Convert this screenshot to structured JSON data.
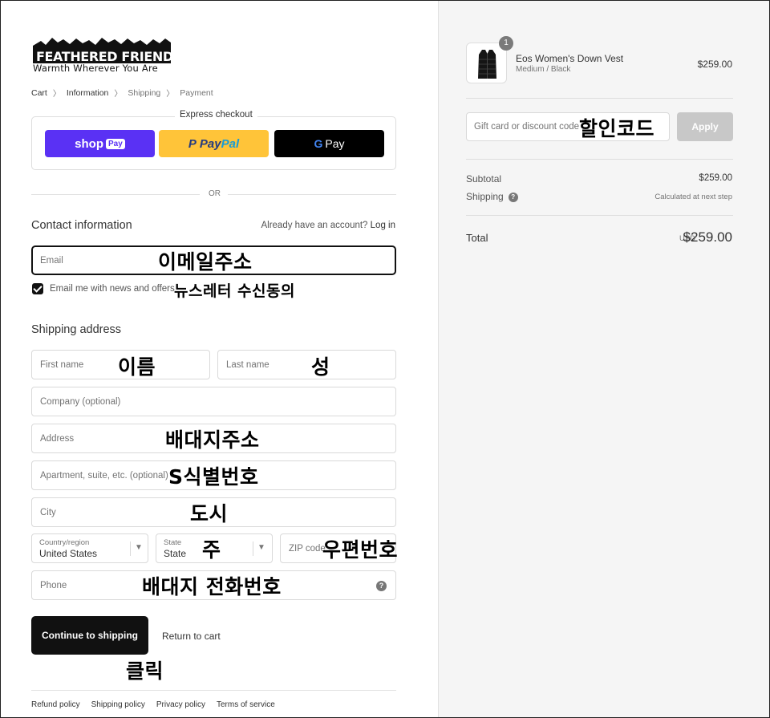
{
  "brand": {
    "name": "FEATHERED FRIENDS",
    "tagline": "Warmth Wherever You Are"
  },
  "breadcrumb": [
    "Cart",
    "Information",
    "Shipping",
    "Payment"
  ],
  "express": {
    "title": "Express checkout",
    "shop_pay": "shop",
    "shop_pay_badge": "Pay",
    "paypal_a": "Pay",
    "paypal_b": "Pal",
    "gpay": "Pay",
    "gpay_g": "G"
  },
  "or_label": "OR",
  "contact": {
    "title": "Contact information",
    "account_prompt": "Already have an account?",
    "login_link": "Log in",
    "email_placeholder": "Email",
    "newsletter_label": "Email me with news and offers",
    "newsletter_checked": true
  },
  "shipping": {
    "title": "Shipping address",
    "first_name": "First name",
    "last_name": "Last name",
    "company": "Company (optional)",
    "address": "Address",
    "apartment": "Apartment, suite, etc. (optional)",
    "city": "City",
    "country_label": "Country/region",
    "country_value": "United States",
    "state_label": "State",
    "state_value": "State",
    "zip": "ZIP code",
    "phone": "Phone"
  },
  "actions": {
    "continue": "Continue to shipping",
    "return": "Return to cart"
  },
  "footer": [
    "Refund policy",
    "Shipping policy",
    "Privacy policy",
    "Terms of service"
  ],
  "annotations": {
    "email": "이메일주소",
    "newsletter": "뉴스레터 수신동의",
    "first_name": "이름",
    "last_name": "성",
    "address": "배대지주소",
    "apartment": "S식별번호",
    "city": "도시",
    "state": "주",
    "zip": "우편번호",
    "phone": "배대지 전화번호",
    "click": "클릭",
    "discount": "할인코드"
  },
  "order": {
    "quantity": "1",
    "product_name": "Eos Women's Down Vest",
    "product_variant": "Medium / Black",
    "product_price": "$259.00",
    "discount_placeholder": "Gift card or discount code",
    "apply": "Apply",
    "subtotal_label": "Subtotal",
    "subtotal_value": "$259.00",
    "shipping_label": "Shipping",
    "shipping_value": "Calculated at next step",
    "total_label": "Total",
    "currency": "USD",
    "total_value": "$259.00"
  },
  "colors": {
    "shop_pay": "#5a31f4",
    "paypal": "#ffc439",
    "gpay": "#000000",
    "primary_button": "#111111",
    "apply_disabled": "#c8c8c8"
  }
}
